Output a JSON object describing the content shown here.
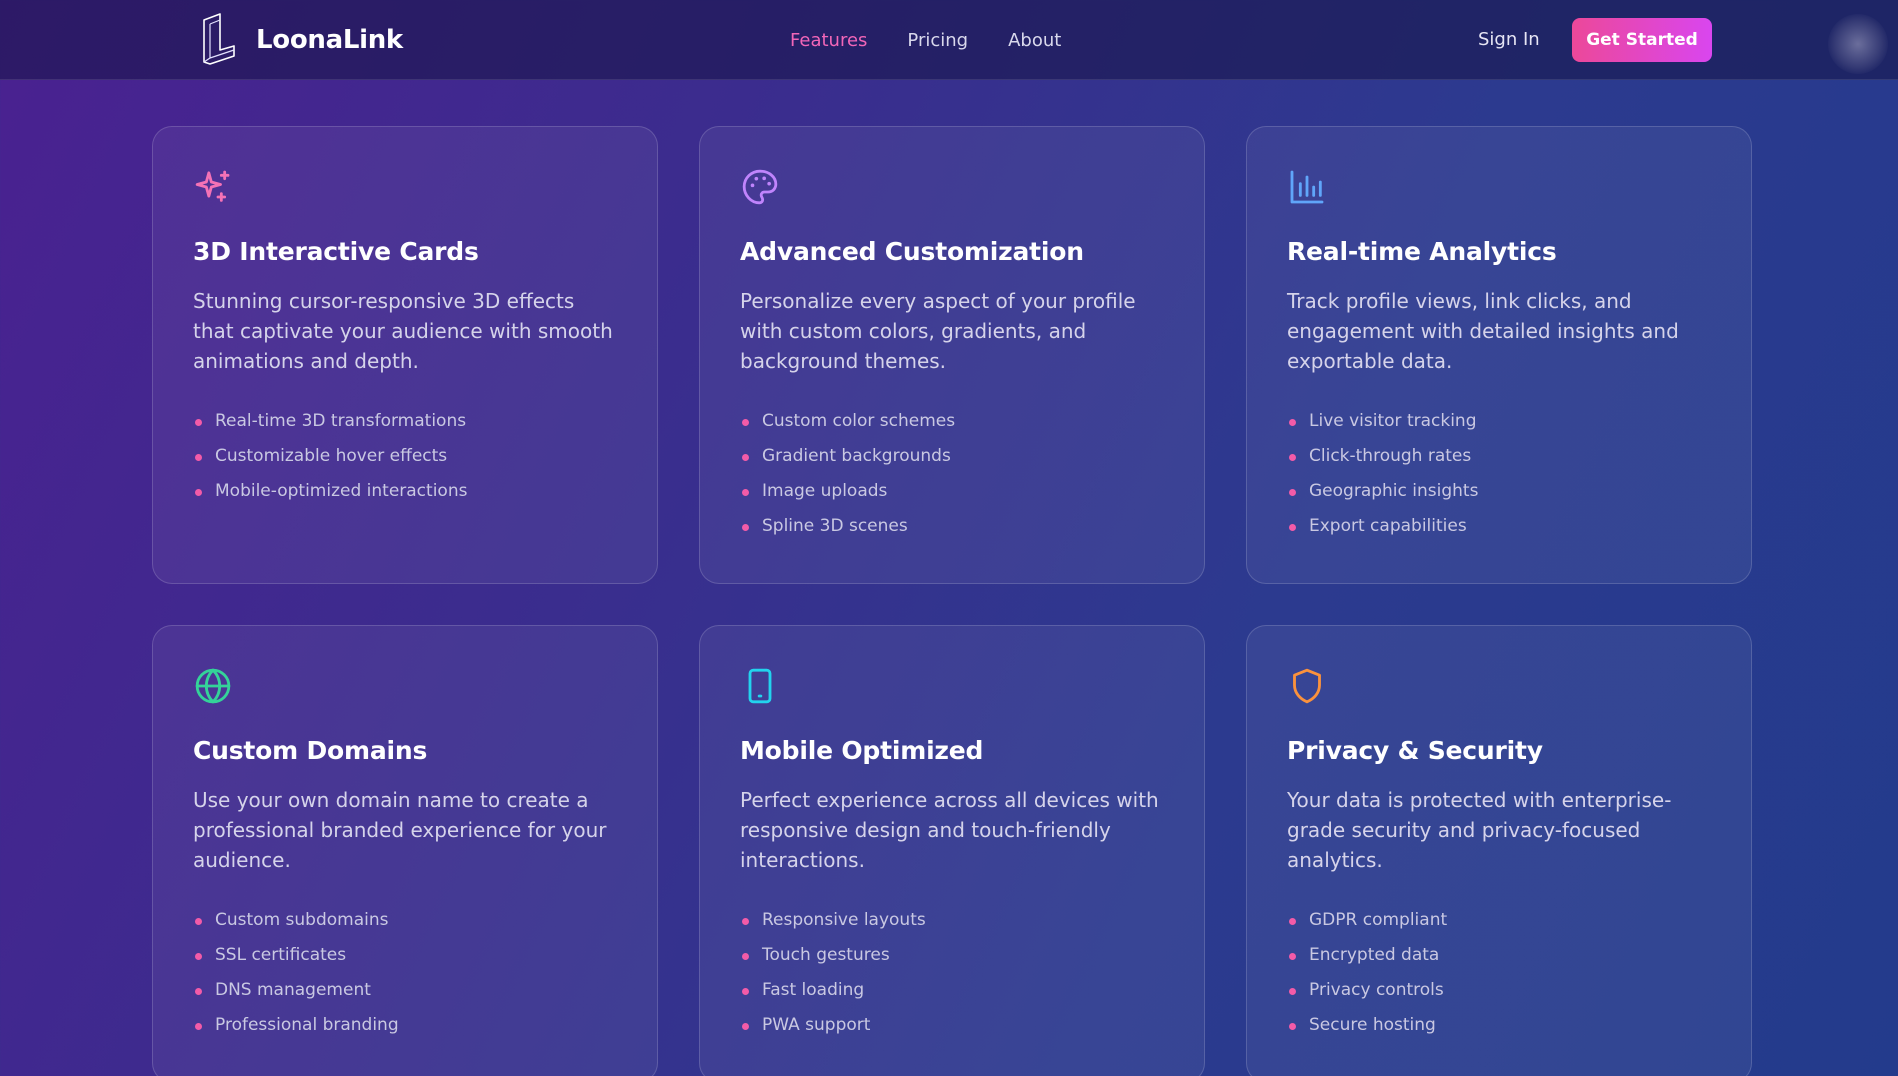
{
  "brand": {
    "name": "LoonaLink",
    "accent_color": "#ec4899"
  },
  "nav": {
    "links": [
      "Features",
      "Pricing",
      "About"
    ],
    "active": "Features",
    "sign_in": "Sign In",
    "cta": "Get Started"
  },
  "features": [
    {
      "icon": "sparkles-icon",
      "icon_color": "#f472b6",
      "title": "3D Interactive Cards",
      "description": "Stunning cursor-responsive 3D effects that captivate your audience with smooth animations and depth.",
      "bullets": [
        "Real-time 3D transformations",
        "Customizable hover effects",
        "Mobile-optimized interactions"
      ]
    },
    {
      "icon": "palette-icon",
      "icon_color": "#c084fc",
      "title": "Advanced Customization",
      "description": "Personalize every aspect of your profile with custom colors, gradients, and background themes.",
      "bullets": [
        "Custom color schemes",
        "Gradient backgrounds",
        "Image uploads",
        "Spline 3D scenes"
      ]
    },
    {
      "icon": "bar-chart-icon",
      "icon_color": "#60a5fa",
      "title": "Real-time Analytics",
      "description": "Track profile views, link clicks, and engagement with detailed insights and exportable data.",
      "bullets": [
        "Live visitor tracking",
        "Click-through rates",
        "Geographic insights",
        "Export capabilities"
      ]
    },
    {
      "icon": "globe-icon",
      "icon_color": "#34d399",
      "title": "Custom Domains",
      "description": "Use your own domain name to create a professional branded experience for your audience.",
      "bullets": [
        "Custom subdomains",
        "SSL certificates",
        "DNS management",
        "Professional branding"
      ]
    },
    {
      "icon": "smartphone-icon",
      "icon_color": "#22d3ee",
      "title": "Mobile Optimized",
      "description": "Perfect experience across all devices with responsive design and touch-friendly interactions.",
      "bullets": [
        "Responsive layouts",
        "Touch gestures",
        "Fast loading",
        "PWA support"
      ]
    },
    {
      "icon": "shield-icon",
      "icon_color": "#fb923c",
      "title": "Privacy & Security",
      "description": "Your data is protected with enterprise-grade security and privacy-focused analytics.",
      "bullets": [
        "GDPR compliant",
        "Encrypted data",
        "Privacy controls",
        "Secure hosting"
      ]
    }
  ]
}
